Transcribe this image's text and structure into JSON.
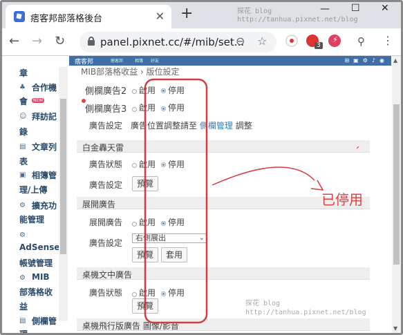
{
  "browser": {
    "tab_title": "痞客邦部落格後台",
    "tab_close": "✕",
    "new_tab": "+",
    "window_controls": [
      "—",
      "☐",
      "✕"
    ],
    "url": "panel.pixnet.cc/#/mib/set...",
    "extension_badge": "3"
  },
  "watermark": {
    "line1": "探花 blog",
    "line2": "http://tanhua.pixnet.net/blog"
  },
  "appbar": {
    "logo": "痞客邦",
    "nav": [
      "痞客邦",
      "相簿",
      "好友"
    ]
  },
  "sidebar": {
    "items": [
      {
        "label": "章"
      },
      {
        "label": "合作機",
        "icon": "♣"
      },
      {
        "label": "會",
        "badge": "NEW"
      },
      {
        "label": "拜訪記",
        "icon": "☺"
      },
      {
        "label": "錄"
      },
      {
        "label": "文章列",
        "icon": "▤"
      },
      {
        "label": "表"
      },
      {
        "label": "相簿管",
        "icon": "▣"
      },
      {
        "label": "理/上傳"
      },
      {
        "label": "擴充功",
        "icon": "⚙"
      },
      {
        "label": "能管理"
      },
      {
        "label": "",
        "icon": "⚙"
      },
      {
        "label": "AdSense"
      },
      {
        "label": "帳號管理"
      },
      {
        "label": "MIB",
        "icon": "⚙"
      },
      {
        "label": "部落格收"
      },
      {
        "label": "益"
      },
      {
        "label": "側欄管",
        "icon": "▤"
      },
      {
        "label": "理"
      }
    ]
  },
  "main": {
    "breadcrumb": "MIB部落格收益 › 版位設定",
    "sidebar_ad2": {
      "label": "側欄廣告2",
      "enabled": "啟用",
      "disabled": "停用"
    },
    "sidebar_ad3": {
      "label": "側欄廣告3",
      "enabled": "啟用",
      "disabled": "停用"
    },
    "ad_setting": {
      "label": "廣告設定",
      "text_before": "廣告位置調整請至",
      "link": "側欄管理",
      "text_after": "調整"
    },
    "section_platinum": {
      "title": "白金轟天雷",
      "status_label": "廣告狀態",
      "enabled": "啟用",
      "disabled": "停用",
      "setting_label": "廣告設定",
      "preview": "預覽"
    },
    "section_expand": {
      "title": "展開廣告",
      "ad_label": "展開廣告",
      "enabled": "啟用",
      "disabled": "停用",
      "setting_label": "廣告設定",
      "select_value": "右側展出",
      "preview": "預覽",
      "apply": "套用"
    },
    "section_desktop": {
      "title": "桌機文中廣告",
      "status_label": "廣告狀態",
      "enabled": "啟用",
      "disabled": "停用",
      "preview": "預覽"
    },
    "section_flying": {
      "title": "桌機飛行版廣告 圖像/影音"
    }
  },
  "annotation": {
    "text": "已停用",
    "color": "#e24040"
  }
}
